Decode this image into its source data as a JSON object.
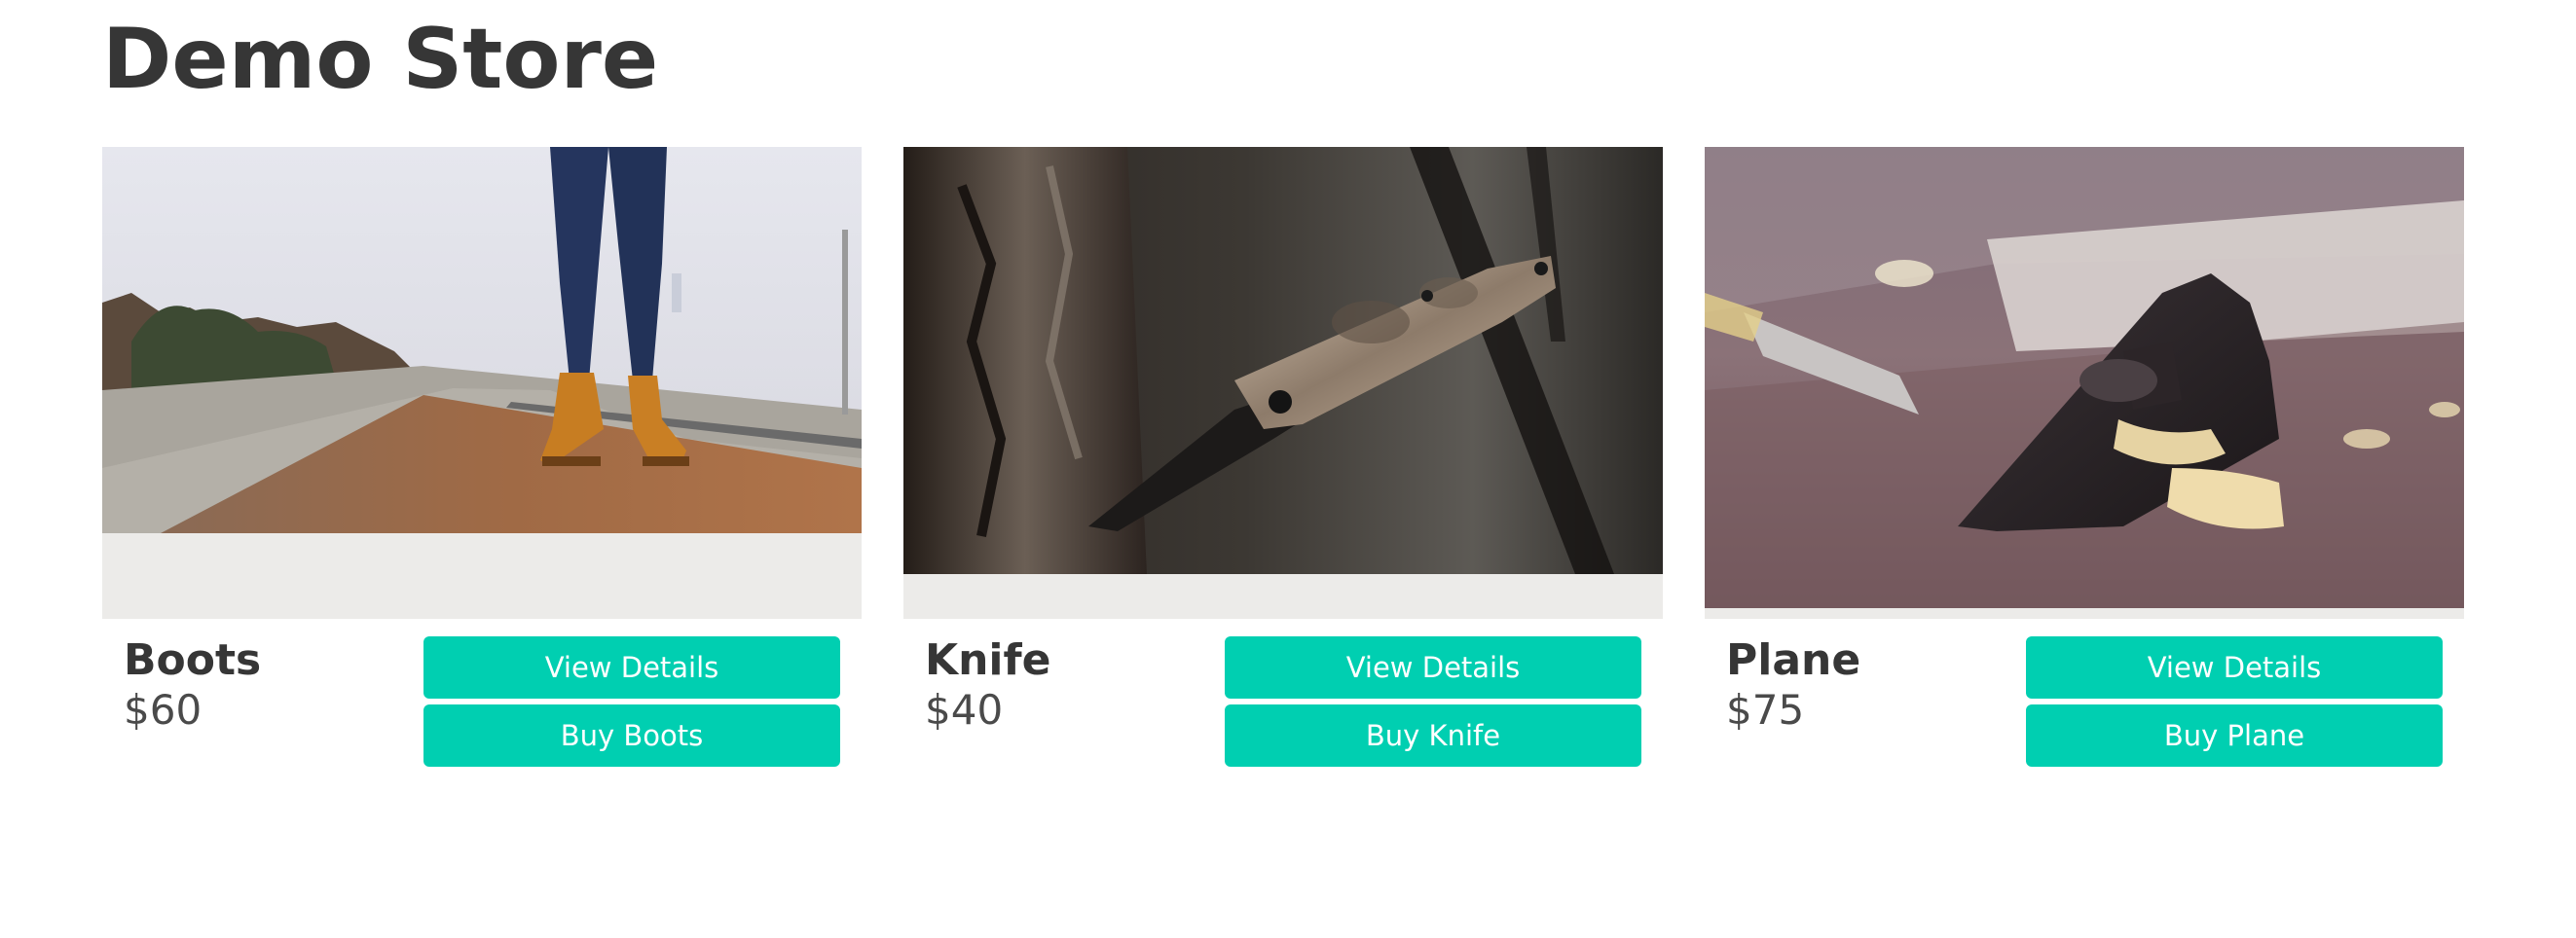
{
  "store": {
    "title": "Demo Store"
  },
  "colors": {
    "accent": "#00cfb1",
    "text": "#363636",
    "frame": "#ecebe9"
  },
  "products": [
    {
      "name": "Boots",
      "price": "$60",
      "image": "boots-photo",
      "view_label": "View Details",
      "buy_label": "Buy Boots"
    },
    {
      "name": "Knife",
      "price": "$40",
      "image": "knife-photo",
      "view_label": "View Details",
      "buy_label": "Buy Knife"
    },
    {
      "name": "Plane",
      "price": "$75",
      "image": "plane-photo",
      "view_label": "View Details",
      "buy_label": "Buy Plane"
    }
  ]
}
